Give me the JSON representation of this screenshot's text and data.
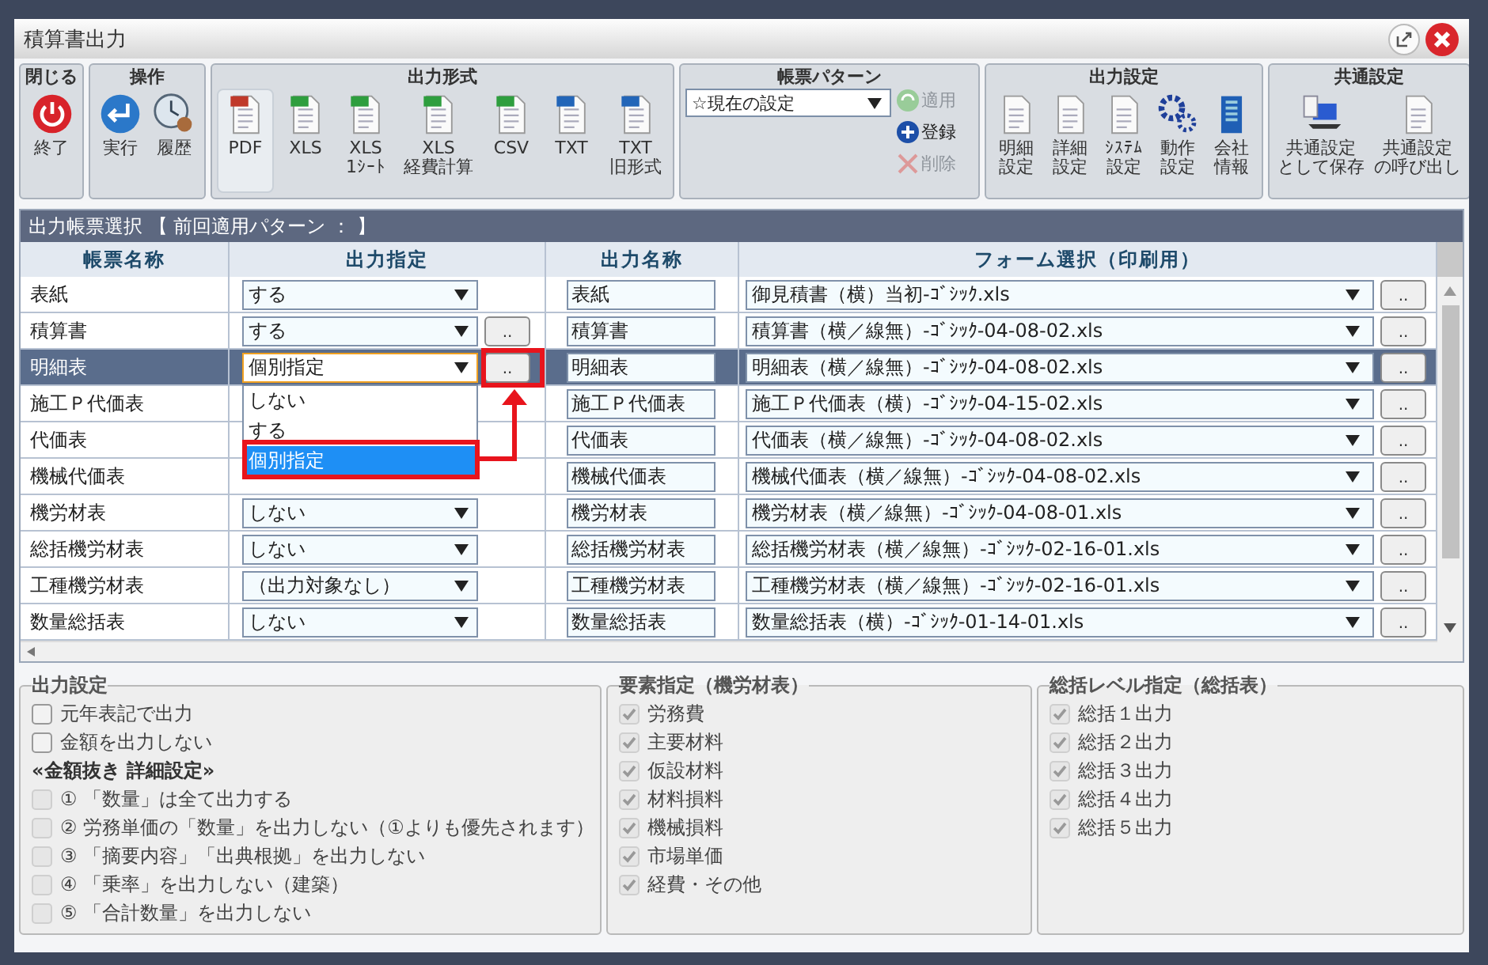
{
  "window": {
    "title": "積算書出力"
  },
  "toolbar": [
    {
      "label": "閉じる",
      "kind": "tools",
      "items": [
        {
          "label": "終了",
          "kind": "power"
        }
      ]
    },
    {
      "label": "操作",
      "kind": "tools",
      "items": [
        {
          "label": "実行",
          "kind": "enter"
        },
        {
          "label": "履歴",
          "kind": "clock"
        }
      ]
    },
    {
      "label": "出力形式",
      "kind": "formats",
      "items": [
        {
          "label": "PDF",
          "kind": "pdf",
          "selected": true
        },
        {
          "label": "XLS",
          "kind": "xls",
          "selected": false
        },
        {
          "label": "XLS\n1ｼｰﾄ",
          "kind": "xls",
          "selected": false
        },
        {
          "label": "XLS\n経費計算",
          "kind": "xls",
          "selected": false
        },
        {
          "label": "CSV",
          "kind": "xls",
          "selected": false
        },
        {
          "label": "TXT",
          "kind": "txt",
          "selected": false
        },
        {
          "label": "TXT\n旧形式",
          "kind": "txt",
          "selected": false
        }
      ]
    },
    {
      "label": "帳票パターン",
      "kind": "pattern",
      "select": "☆現在の設定",
      "buttons": [
        {
          "label": "適用",
          "kind": "apply",
          "disabled": true
        },
        {
          "label": "登録",
          "kind": "add",
          "disabled": false
        },
        {
          "label": "削除",
          "kind": "delete",
          "disabled": true
        }
      ]
    },
    {
      "label": "出力設定",
      "kind": "tools",
      "items": [
        {
          "label": "明細設定",
          "kind": "doc"
        },
        {
          "label": "詳細設定",
          "kind": "list"
        },
        {
          "label": "ｼｽﾃﾑ設定",
          "kind": "doc"
        },
        {
          "label": "動作設定",
          "kind": "gear"
        },
        {
          "label": "会社情報",
          "kind": "building"
        }
      ]
    },
    {
      "label": "共通設定",
      "kind": "tools",
      "items": [
        {
          "label": "共通設定として保存",
          "kind": "laptop"
        },
        {
          "label": "共通設定の呼び出し",
          "kind": "list"
        }
      ]
    }
  ],
  "table": {
    "title": "出力帳票選択 【 前回適用パターン ： 】",
    "columns": [
      "帳票名称",
      "出力指定",
      "出力名称",
      "フォーム選択（印刷用）"
    ],
    "rows": [
      {
        "name": "表紙",
        "selected": false,
        "output": "する",
        "output_name": "表紙",
        "form": "御見積書（横）当初-ｺﾞｼｯｸ.xls",
        "form_button": ".."
      },
      {
        "name": "積算書",
        "selected": false,
        "output": "する",
        "output_button": "..",
        "output_name": "積算書",
        "form": "積算書（横／線無）-ｺﾞｼｯｸ-04-08-02.xls",
        "form_button": ".."
      },
      {
        "name": "明細表",
        "selected": true,
        "output": "個別指定",
        "output_button": "..",
        "output_name": "明細表",
        "form": "明細表（横／線無）-ｺﾞｼｯｸ-04-08-02.xls",
        "form_button": ".."
      },
      {
        "name": "施工Ｐ代価表",
        "selected": false,
        "output_name": "施工Ｐ代価表",
        "form": "施工Ｐ代価表（横）-ｺﾞｼｯｸ-04-15-02.xls",
        "form_button": ".."
      },
      {
        "name": "代価表",
        "selected": false,
        "output_name": "代価表",
        "form": "代価表（横／線無）-ｺﾞｼｯｸ-04-08-02.xls",
        "form_button": ".."
      },
      {
        "name": "機械代価表",
        "selected": false,
        "output_name": "機械代価表",
        "form": "機械代価表（横／線無）-ｺﾞｼｯｸ-04-08-02.xls",
        "form_button": ".."
      },
      {
        "name": "機労材表",
        "selected": false,
        "output": "しない",
        "output_name": "機労材表",
        "form": "機労材表（横／線無）-ｺﾞｼｯｸ-04-08-01.xls",
        "form_button": ".."
      },
      {
        "name": "総括機労材表",
        "selected": false,
        "output": "しない",
        "output_name": "総括機労材表",
        "form": "総括機労材表（横／線無）-ｺﾞｼｯｸ-02-16-01.xls",
        "form_button": ".."
      },
      {
        "name": "工種機労材表",
        "selected": false,
        "output": "（出力対象なし）",
        "output_name": "工種機労材表",
        "form": "工種機労材表（横／線無）-ｺﾞｼｯｸ-02-16-01.xls",
        "form_button": ".."
      },
      {
        "name": "数量総括表",
        "selected": false,
        "output": "しない",
        "output_name": "数量総括表",
        "form": "数量総括表（横）-ｺﾞｼｯｸ-01-14-01.xls",
        "form_button": ".."
      }
    ],
    "dropdown": [
      {
        "label": "しない",
        "selected": false
      },
      {
        "label": "する",
        "selected": false
      },
      {
        "label": "個別指定",
        "selected": true
      }
    ]
  },
  "panels": [
    {
      "title": "出力設定",
      "items": [
        {
          "kind": "checkbox",
          "label": "元年表記で出力",
          "checked": false,
          "disabled": false
        },
        {
          "kind": "checkbox",
          "label": "金額を出力しない",
          "checked": false,
          "disabled": false
        },
        {
          "kind": "heading",
          "label": "«金額抜き 詳細設定»"
        },
        {
          "kind": "checkbox",
          "label": "① 「数量」は全て出力する",
          "checked": false,
          "disabled": true
        },
        {
          "kind": "checkbox",
          "label": "② 労務単価の「数量」を出力しない（①よりも優先されます）",
          "checked": false,
          "disabled": true
        },
        {
          "kind": "checkbox",
          "label": "③ 「摘要内容」「出典根拠」を出力しない",
          "checked": false,
          "disabled": true
        },
        {
          "kind": "checkbox",
          "label": "④ 「乗率」を出力しない（建築）",
          "checked": false,
          "disabled": true
        },
        {
          "kind": "checkbox",
          "label": "⑤ 「合計数量」を出力しない",
          "checked": false,
          "disabled": true
        }
      ]
    },
    {
      "title": "要素指定（機労材表）",
      "items": [
        {
          "kind": "checkbox",
          "label": "労務費",
          "checked": true,
          "disabled": true
        },
        {
          "kind": "checkbox",
          "label": "主要材料",
          "checked": true,
          "disabled": true
        },
        {
          "kind": "checkbox",
          "label": "仮設材料",
          "checked": true,
          "disabled": true
        },
        {
          "kind": "checkbox",
          "label": "材料損料",
          "checked": true,
          "disabled": true
        },
        {
          "kind": "checkbox",
          "label": "機械損料",
          "checked": true,
          "disabled": true
        },
        {
          "kind": "checkbox",
          "label": "市場単価",
          "checked": true,
          "disabled": true
        },
        {
          "kind": "checkbox",
          "label": "経費・その他",
          "checked": true,
          "disabled": true
        }
      ]
    },
    {
      "title": "総括レベル指定（総括表）",
      "items": [
        {
          "kind": "checkbox",
          "label": "総括１出力",
          "checked": true,
          "disabled": true
        },
        {
          "kind": "checkbox",
          "label": "総括２出力",
          "checked": true,
          "disabled": true
        },
        {
          "kind": "checkbox",
          "label": "総括３出力",
          "checked": true,
          "disabled": true
        },
        {
          "kind": "checkbox",
          "label": "総括４出力",
          "checked": true,
          "disabled": true
        },
        {
          "kind": "checkbox",
          "label": "総括５出力",
          "checked": true,
          "disabled": true
        }
      ]
    }
  ]
}
